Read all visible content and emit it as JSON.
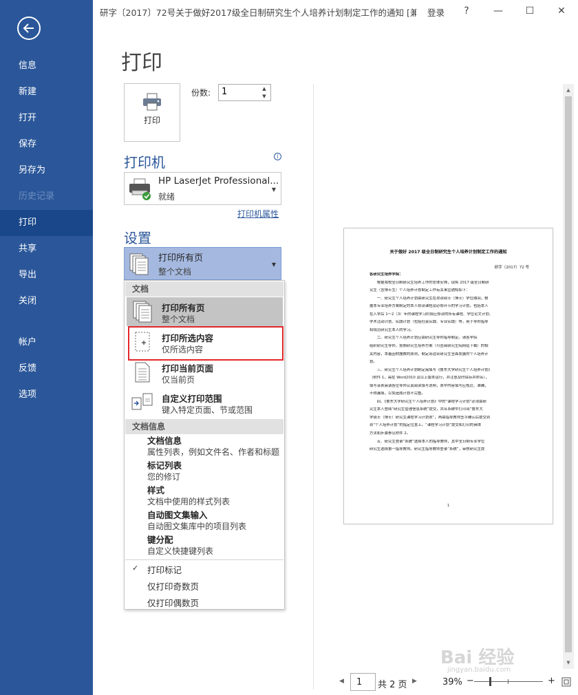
{
  "window": {
    "title": "研字〔2017〕72号关于做好2017级全日制研究生个人培养计划制定工作的通知 [兼...",
    "login": "登录",
    "help": "?",
    "minimize": "—",
    "maximize": "☐",
    "close": "✕"
  },
  "nav": {
    "items": [
      {
        "label": "信息"
      },
      {
        "label": "新建"
      },
      {
        "label": "打开"
      },
      {
        "label": "保存"
      },
      {
        "label": "另存为"
      },
      {
        "label": "历史记录"
      },
      {
        "label": "打印"
      },
      {
        "label": "共享"
      },
      {
        "label": "导出"
      },
      {
        "label": "关闭"
      },
      {
        "label": "帐户"
      },
      {
        "label": "反馈"
      },
      {
        "label": "选项"
      }
    ],
    "active": "打印",
    "disabled": "历史记录"
  },
  "print": {
    "page_title": "打印",
    "button_label": "打印",
    "copies_label": "份数:",
    "copies_value": "1"
  },
  "printer": {
    "heading": "打印机",
    "info": "i",
    "name": "HP LaserJet Professional...",
    "status": "就绪",
    "properties_link": "打印机属性"
  },
  "settings": {
    "heading": "设置",
    "selected_main": "打印所有页",
    "selected_sub": "整个文档"
  },
  "menu": {
    "section_doc": "文档",
    "options": [
      {
        "title": "打印所有页",
        "sub": "整个文档",
        "icon": "all-pages-icon"
      },
      {
        "title": "打印所选内容",
        "sub": "仅所选内容",
        "icon": "selection-icon"
      },
      {
        "title": "打印当前页面",
        "sub": "仅当前页",
        "icon": "current-page-icon"
      },
      {
        "title": "自定义打印范围",
        "sub": "键入特定页面、节或范围",
        "icon": "custom-range-icon"
      }
    ],
    "section_info": "文档信息",
    "info_items": [
      {
        "title": "文档信息",
        "sub": "属性列表，例如文件名、作者和标题"
      },
      {
        "title": "标记列表",
        "sub": "您的修订"
      },
      {
        "title": "样式",
        "sub": "文档中使用的样式列表"
      },
      {
        "title": "自动图文集输入",
        "sub": "自动图文集库中的项目列表"
      },
      {
        "title": "键分配",
        "sub": "自定义快捷键列表"
      }
    ],
    "print_markup": "打印标记",
    "check": "✓",
    "odd_only": "仅打印奇数页",
    "even_only": "仅打印偶数页"
  },
  "preview": {
    "title": "关于做好 2017 级全日制研究生个人培养计划制定工作的通知",
    "docno": "研字〔2017〕72 号",
    "lines": [
      "各研究生培养学院：",
      "　　根据我校全日制研究生培养工作的总体安排，现将 2017 级全日制研",
      "究生（含博士生）个人培养计划制定工作有关事宜通知如下：",
      "　　一、研究生个人培养计划由研究生在攻读硕士（博士）学位期间，根",
      "据本专业培养方案制定的本人修读课程及必修环节的学习计划，包括本人",
      "在入学后 1～2（3）年的课程学习阶段应修读的所有课程、学位论文计划、",
      "学术活动计划、实践计划（包括社会实践、专业实践）等，用于导师指导",
      "和规范研究生本人的学习。",
      "　　二、研究生个人培养计划应由研究生导师指导制定。请各学院",
      "组织研究生导师，按照研究生培养方案（可查阅研究生院网站下载）的相",
      "关内容，本着因材施教的原则，制定出适合研究生全面发展的个人培养计",
      "划。",
      "　　三、研究生个人培养计划制定需填写《鲁东大学研究生个人培养计划》",
      "（附件 1，需在 Word2010 及以上版本运行，并注意及时保存并命名），",
      "填写该表需请各位导师认真阅读填写说明，表中内容填写应规范、准确，",
      "不得漏填，以免造成计划不完整。",
      "　　四、《鲁东大学研究生个人培养计划》中的“课程学习计划”必须由研",
      "究生本人登陆“研究生管理信息系统”提交，并从系统中打印出“鲁东大",
      "学硕士（博士）研究生课程学习计划表”，再由指导教师签字确认后提交到",
      "到“个人培养计划”的指定位置上。“课程学习计划”提交和打印的具体",
      "方法和步骤参见附件 2。",
      "　　五、研究生登录“系统”选择本人的指导教师，其中全日制专业学位",
      "研究生选择第一指导教师。研究生指导教师登录“系统”，审核研究生提"
    ],
    "page_number": "1"
  },
  "footer": {
    "current_page": "1",
    "total_pages": "共 2 页",
    "zoom": "39%",
    "zoom_minus": "−",
    "zoom_plus": "+"
  },
  "watermark": {
    "brand": "Bai 经验",
    "url": "jingyan.baidu.com"
  }
}
